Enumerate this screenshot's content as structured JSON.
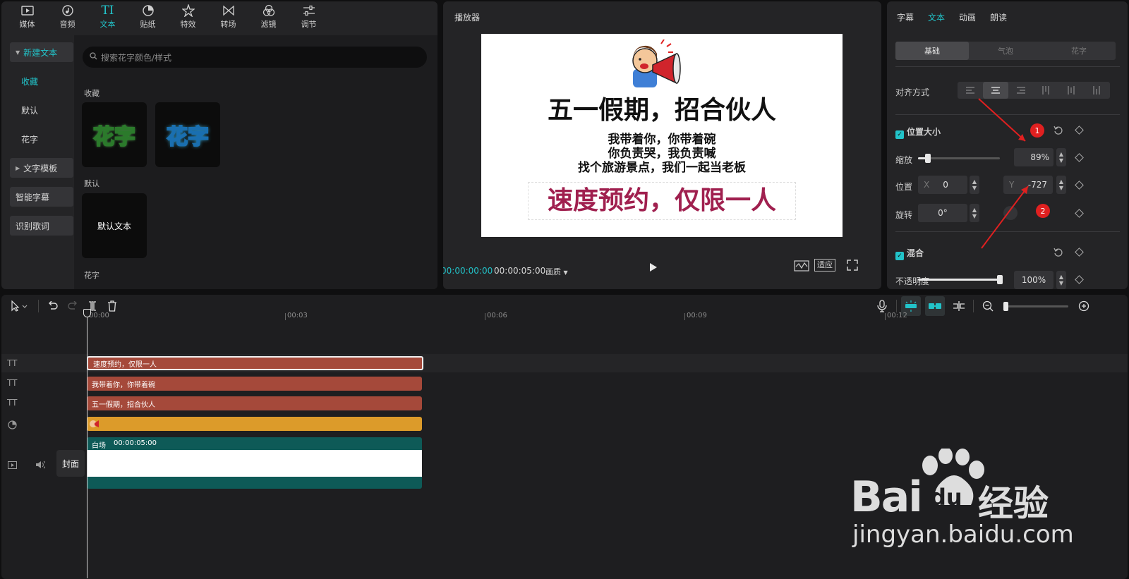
{
  "media": {
    "tabs": [
      {
        "label": "媒体",
        "icon": "media-icon"
      },
      {
        "label": "音频",
        "icon": "audio-icon"
      },
      {
        "label": "文本",
        "icon": "text-icon",
        "active": true
      },
      {
        "label": "贴纸",
        "icon": "sticker-icon"
      },
      {
        "label": "特效",
        "icon": "effects-icon"
      },
      {
        "label": "转场",
        "icon": "transition-icon"
      },
      {
        "label": "滤镜",
        "icon": "filter-icon"
      },
      {
        "label": "调节",
        "icon": "adjust-icon"
      }
    ],
    "text_tab_icon_glyph": "TI",
    "sidebar": {
      "new_text": "新建文本",
      "favorites": "收藏",
      "default": "默认",
      "fancy": "花字",
      "template": "文字模板",
      "smart_caption": "智能字幕",
      "lyrics": "识别歌词"
    },
    "search_placeholder": "搜索花字颜色/样式",
    "section_favorites": "收藏",
    "section_default": "默认",
    "section_fancy": "花字",
    "fancy_thumb_1": "花字",
    "fancy_thumb_2": "花字",
    "default_thumb": "默认文本"
  },
  "player": {
    "title": "播放器",
    "canvas": {
      "headline": "五一假期，招合伙人",
      "line1": "我带着你，你带着碗",
      "line2": "你负责哭，我负责喊",
      "line3": "找个旅游景点，我们一起当老板",
      "cta": "速度预约，仅限一人"
    },
    "time_current": "00:00:00:00",
    "time_total": "00:00:05:00",
    "quality": "画质",
    "fit": "适应"
  },
  "props": {
    "tabs": [
      "字幕",
      "文本",
      "动画",
      "朗读"
    ],
    "active_tab": "文本",
    "subtabs": [
      "基础",
      "气泡",
      "花字"
    ],
    "align_label": "对齐方式",
    "section_position": "位置大小",
    "scale_label": "缩放",
    "scale_value": "89%",
    "scale_fraction": 0.12,
    "position_label": "位置",
    "x_label": "X",
    "x_value": "0",
    "y_label": "Y",
    "y_value": "-727",
    "rotate_label": "旋转",
    "rotate_value": "0°",
    "section_blend": "混合",
    "opacity_label": "不透明度",
    "opacity_value": "100%",
    "opacity_fraction": 1.0,
    "badge1": "1",
    "badge2": "2",
    "accent": "#22c3c9",
    "annotation_color": "#e02020"
  },
  "timeline": {
    "ruler": [
      "00:00",
      "00:03",
      "00:06",
      "00:09",
      "00:12"
    ],
    "text_glyph": "TT",
    "clips": {
      "cta": "速度预约，仅限一人",
      "line1": "我带着你，你带着碗",
      "headline": "五一假期，招合伙人",
      "video_label": "白场",
      "video_duration": "00:00:05:00"
    },
    "cover": "封面",
    "colors": {
      "text_clip": "#a5493a",
      "sticker_clip": "#dc9b2a",
      "video_clip": "#0e5a57"
    }
  },
  "watermark": {
    "brand": "Bai",
    "brand_du": "du",
    "brand_cn": "经验",
    "url": "jingyan.baidu.com"
  }
}
